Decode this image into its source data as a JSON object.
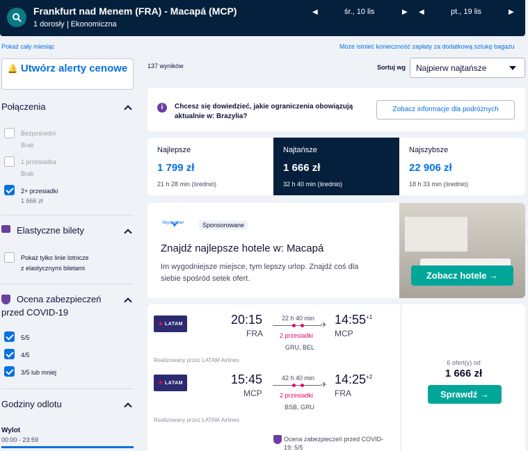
{
  "header": {
    "route": "Frankfurt nad Menem (FRA) - Macapá (MCP)",
    "passengers": "1 dorosły",
    "cabin": "Ekonomiczna",
    "depart_date": "śr., 10 lis",
    "return_date": "pt., 19 lis"
  },
  "links": {
    "whole_month": "Pokaż cały miesiąc",
    "bag_fee": "Może istnieć konieczność zapłaty za dodatkową sztukę bagażu"
  },
  "alert_button": "Utwórz alerty cenowe",
  "results": {
    "count": "137 wyników",
    "sort_label": "Sortuj wg",
    "sort_value": "Najpierw najtańsze"
  },
  "filters": {
    "connections": {
      "title": "Połączenia",
      "items": [
        {
          "label": "Bezpośredni",
          "sub": "Brak",
          "checked": false
        },
        {
          "label": "1 przesiadka",
          "sub": "Brak",
          "checked": false
        },
        {
          "label": "2+ przesiadki",
          "sub": "1 666 zł",
          "checked": true
        }
      ]
    },
    "flexible": {
      "title": "Elastyczne bilety",
      "item": "Pokaż tylko linie lotnicze",
      "item2": "z elastycznymi biletami"
    },
    "covid": {
      "title": "Ocena zabezpieczeń",
      "title2": "przed COVID-19",
      "items": [
        "5/5",
        "4/5",
        "3/5 lub mniej"
      ]
    },
    "departure": {
      "title": "Godziny odlotu",
      "sub": "Wylot",
      "range": "00:00 - 23:59"
    }
  },
  "covid_info": {
    "text1": "Chcesz się dowiedzieć, jakie ograniczenia obowiązują",
    "text2": "aktualnie w: Brazylia?",
    "button": "Zobacz informacje dla podróżnych"
  },
  "tabs": [
    {
      "label": "Najlepsze",
      "price": "1 799 zł",
      "time": "21 h 28 min (średnio)"
    },
    {
      "label": "Najtańsze",
      "price": "1 666 zł",
      "time": "32 h 40 min (średnio)"
    },
    {
      "label": "Najszybsze",
      "price": "22 906 zł",
      "time": "18 h 33 min (średnio)"
    }
  ],
  "ad": {
    "brand": "Skyscanner",
    "sponsored": "Sponsorowane",
    "title": "Znajdź najlepsze hotele w: Macapá",
    "body1": "Im wygodniejsze miejsce, tym lepszy urlop. Znajdź coś dla",
    "body2": "siebie spośród setek ofert.",
    "button": "Zobacz hotele"
  },
  "flight": {
    "airline": "LATAM",
    "airline_sub": "AIRLINES",
    "outbound": {
      "dep": "20:15",
      "dep_code": "FRA",
      "arr": "14:55",
      "arr_plus": "+1",
      "arr_code": "MCP",
      "duration": "22 h 40 min",
      "stops": "2 przesiadki",
      "via": "GRU, BEL",
      "operator": "Realizowany przez LATAM Airlines"
    },
    "inbound": {
      "dep": "15:45",
      "dep_code": "MCP",
      "arr": "14:25",
      "arr_plus": "+2",
      "arr_code": "FRA",
      "duration": "42 h 40 min",
      "stops": "2 przesiadki",
      "via": "BSB, GRU",
      "operator": "Realizowany przez LATAM Airlines"
    },
    "covid": "Ocena zabezpieczeń przed COVID-",
    "covid2": "19: 5/5",
    "offers": "6 ofert(y) od",
    "price": "1 666 zł",
    "button": "Sprawdź"
  }
}
